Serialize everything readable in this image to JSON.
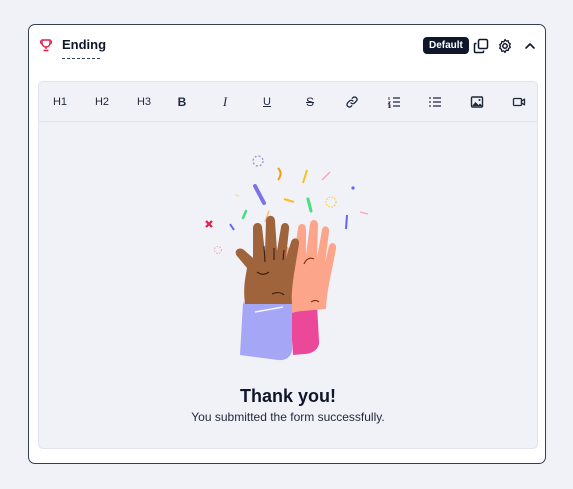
{
  "card": {
    "title": "Ending",
    "badge": "Default"
  },
  "toolbar": {
    "h1": "H1",
    "h2": "H2",
    "h3": "H3",
    "bold": "B",
    "italic": "I",
    "underline": "U",
    "strike": "S"
  },
  "content": {
    "heading": "Thank you!",
    "subheading": "You submitted the form successfully."
  },
  "icons": [
    "trophy-icon",
    "copy-icon",
    "gear-icon",
    "chevron-up-icon",
    "link-icon",
    "ordered-list-icon",
    "bullet-list-icon",
    "image-icon",
    "video-icon"
  ],
  "colors": {
    "accent_trophy": "#e11d48",
    "badge_bg": "#0f172a",
    "editor_bg": "#f1f1f8"
  }
}
